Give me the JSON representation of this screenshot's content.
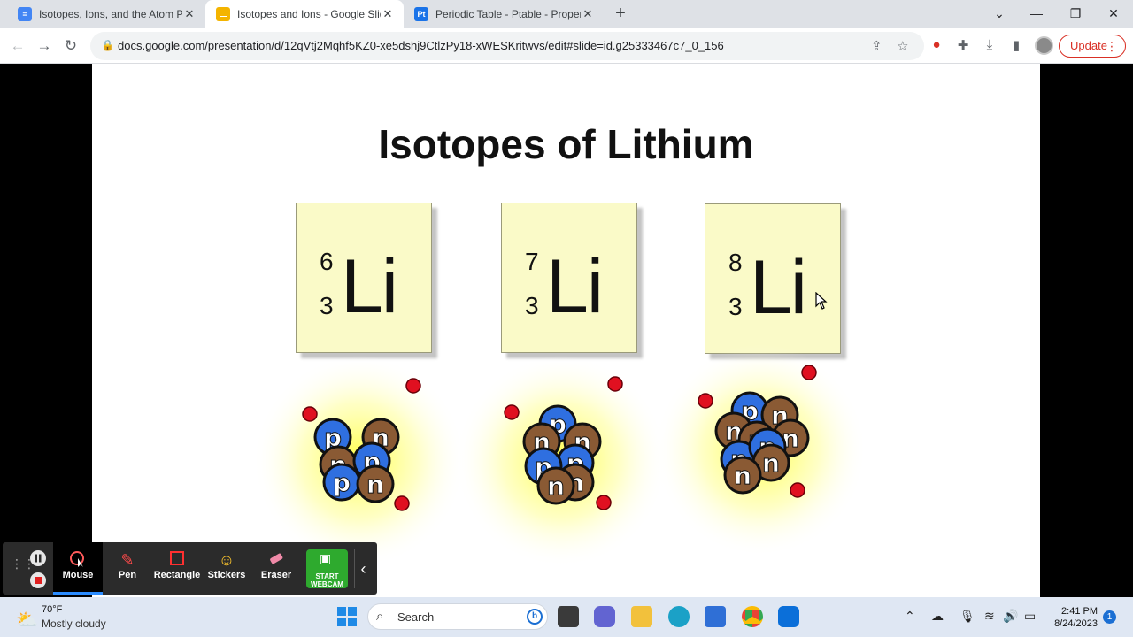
{
  "browser": {
    "tabs": [
      {
        "title": "Isotopes, Ions, and the Atom Pra",
        "icon": "docs-icon",
        "color": "#4285f4",
        "active": false
      },
      {
        "title": "Isotopes and Ions - Google Slide",
        "icon": "slides-icon",
        "color": "#f4b400",
        "active": true
      },
      {
        "title": "Periodic Table - Ptable - Properti",
        "icon": "ptable-icon",
        "color": "#1a73e8",
        "active": false
      }
    ],
    "url": "docs.google.com/presentation/d/12qVtj2Mqhf5KZ0-xe5dshj9CtlzPy18-xWESKritwvs/edit#slide=id.g25333467c7_0_156",
    "update_label": "Update"
  },
  "slide": {
    "title": "Isotopes of Lithium",
    "isotopes": [
      {
        "mass_number": "6",
        "atomic_number": "3",
        "symbol": "Li"
      },
      {
        "mass_number": "7",
        "atomic_number": "3",
        "symbol": "Li"
      },
      {
        "mass_number": "8",
        "atomic_number": "3",
        "symbol": "Li"
      }
    ],
    "particle_labels": {
      "proton": "p",
      "neutron": "n"
    },
    "colors": {
      "proton": "#2f6fe0",
      "neutron": "#8a5a34",
      "electron": "#e01020",
      "card": "#fafac8"
    }
  },
  "recorder": {
    "tools": [
      {
        "label": "Mouse",
        "icon": "mouse-cursor-icon",
        "active": true
      },
      {
        "label": "Pen",
        "icon": "pen-icon",
        "active": false
      },
      {
        "label": "Rectangle",
        "icon": "rectangle-icon",
        "active": false
      },
      {
        "label": "Stickers",
        "icon": "sticker-icon",
        "active": false
      },
      {
        "label": "Eraser",
        "icon": "eraser-icon",
        "active": false
      }
    ],
    "webcam_label": "START WEBCAM"
  },
  "taskbar": {
    "weather_temp": "70°F",
    "weather_desc": "Mostly cloudy",
    "search_placeholder": "Search",
    "time": "2:41 PM",
    "date": "8/24/2023",
    "notification_count": "1"
  }
}
